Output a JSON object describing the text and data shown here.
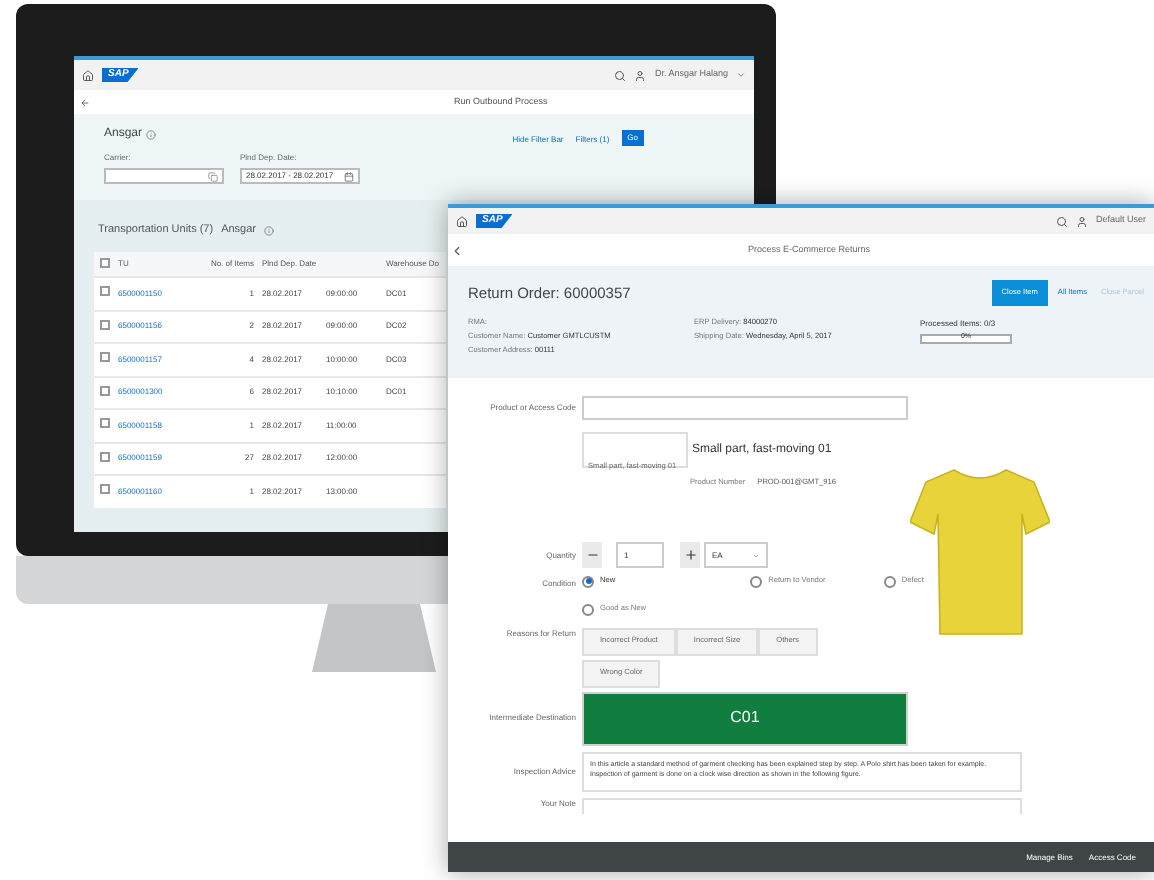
{
  "monitor_app": {
    "shell": {
      "logo": "SAP",
      "user": "Dr. Ansgar Halang"
    },
    "title": "Run Outbound Process",
    "filter": {
      "variant": "Ansgar",
      "fields": [
        {
          "label": "Carrier:",
          "kind": "valuehelp"
        },
        {
          "label": "Plnd Dep. Date:",
          "value": "28.02.2017 - 28.02.2017",
          "kind": "date"
        }
      ],
      "links": [
        "Hide Filter Bar",
        "Filters (1)"
      ],
      "go": "Go"
    },
    "table": {
      "title": "Transportation Units (7)",
      "variant": "Ansgar",
      "all_checked": false,
      "columns": [
        "TU",
        "No. of Items",
        "Plnd Dep. Date",
        "Warehouse Do"
      ],
      "rows": [
        {
          "tu": "6500001150",
          "items": "1",
          "date": "28.02.2017",
          "time": "09:00:00",
          "warehouse": "DC01",
          "checked": false
        },
        {
          "tu": "6500001156",
          "items": "2",
          "date": "28.02.2017",
          "time": "09:00:00",
          "warehouse": "DC02",
          "checked": false
        },
        {
          "tu": "6500001157",
          "items": "4",
          "date": "28.02.2017",
          "time": "10:00:00",
          "warehouse": "DC03",
          "checked": false
        },
        {
          "tu": "6500001300",
          "items": "6",
          "date": "28.02.2017",
          "time": "10:10:00",
          "warehouse": "DC01",
          "checked": false
        },
        {
          "tu": "6500001158",
          "items": "1",
          "date": "28.02.2017",
          "time": "11:00:00",
          "checked": false
        },
        {
          "tu": "6500001159",
          "items": "27",
          "date": "28.02.2017",
          "time": "12:00:00",
          "checked": false
        },
        {
          "tu": "6500001160",
          "items": "1",
          "date": "28.02.2017",
          "time": "13:00:00",
          "checked": false
        }
      ]
    }
  },
  "returns_app": {
    "shell": {
      "logo": "SAP",
      "user": "Default User"
    },
    "title": "Process E-Commerce Returns",
    "header": {
      "title": "Return Order: 60000357",
      "actions": [
        {
          "label": "Close Item",
          "kind": "primary"
        },
        {
          "label": "All Items",
          "kind": "link"
        },
        {
          "label": "Close Parcel",
          "kind": "disabled"
        }
      ],
      "attributes": [
        [
          {
            "label": "RMA:"
          },
          {
            "label": "Customer Name:",
            "value": "Customer GMTLCUSTM"
          },
          {
            "label": "Customer Address:",
            "value": "00111"
          }
        ],
        [
          {
            "label": "ERP Delivery:",
            "value": "84000270"
          },
          {
            "label": "Shipping Date:",
            "value": "Wednesday, April 5, 2017"
          }
        ]
      ],
      "progress": {
        "label": "Processed Items: 0/3",
        "level": 0,
        "reading": "0%"
      }
    },
    "form": {
      "product_code": {
        "label": "Product or Access Code"
      },
      "product": {
        "image_alt": "Small part, fast-moving 01",
        "name": "Small part, fast-moving 01",
        "number_label": "Product Number",
        "number": "PROD-001@GMT_916"
      },
      "quantity": {
        "label": "Quantity",
        "value": "1",
        "unit": "EA"
      },
      "condition": {
        "label": "Condition",
        "options": [
          {
            "label": "New",
            "selected": true
          },
          {
            "label": "Return to Vendor",
            "selected": false
          },
          {
            "label": "Defect",
            "selected": false
          },
          {
            "label": "Good as New",
            "selected": false
          }
        ]
      },
      "reasons": {
        "label": "Reasons for Return",
        "options": [
          {
            "label": "Incorrect Product",
            "selected": false
          },
          {
            "label": "Incorrect Size",
            "selected": false
          },
          {
            "label": "Others",
            "selected": false
          },
          {
            "label": "Wrong Color",
            "selected": false
          }
        ]
      },
      "destination": {
        "label": "Intermediate Destination",
        "value": "C01"
      },
      "inspection": {
        "label": "Inspection Advice",
        "text": "In this article a standard method of garment checking has been explained step by step. A Polo shirt has been taken for example. Inspection of garment is done on a clock wise direction as shown in the following figure."
      },
      "note": {
        "label": "Your Note"
      }
    },
    "footer": [
      "Manage Bins",
      "Access Code"
    ]
  }
}
